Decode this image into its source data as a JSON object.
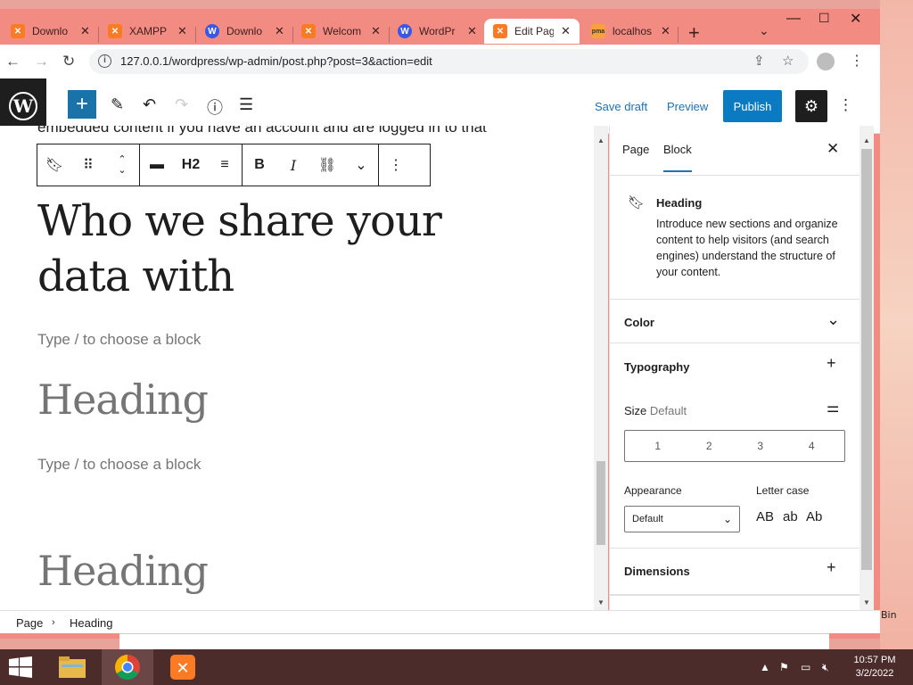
{
  "browser": {
    "tabs": [
      {
        "title": "Downlo",
        "icon": "xampp"
      },
      {
        "title": "XAMPP",
        "icon": "xampp"
      },
      {
        "title": "Downlo",
        "icon": "wordpress"
      },
      {
        "title": "Welcom",
        "icon": "xampp"
      },
      {
        "title": "WordPr",
        "icon": "wordpress"
      },
      {
        "title": "Edit Pag",
        "icon": "xampp"
      },
      {
        "title": "localhos",
        "icon": "phpmyadmin"
      }
    ],
    "active_tab": 5,
    "url": "127.0.0.1/wordpress/wp-admin/post.php?post=3&action=edit"
  },
  "wp_header": {
    "save_draft": "Save draft",
    "preview": "Preview",
    "publish": "Publish"
  },
  "editor": {
    "cut_text": "embedded content if you have an account and are logged in to that",
    "block_toolbar": {
      "heading_level": "H2"
    },
    "heading": "Who we share your data with",
    "placeholder_1": "Type / to choose a block",
    "heading_placeholder_1": "Heading",
    "placeholder_2": "Type / to choose a block",
    "heading_placeholder_2": "Heading"
  },
  "sidebar": {
    "tabs": {
      "page": "Page",
      "block": "Block"
    },
    "block_card": {
      "title": "Heading",
      "description": "Introduce new sections and organize content to help visitors (and search engines) understand the structure of your content."
    },
    "color_panel": "Color",
    "typography_panel": "Typography",
    "size_label": "Size",
    "size_value": "Default",
    "font_sizes": [
      "1",
      "2",
      "3",
      "4"
    ],
    "appearance_label": "Appearance",
    "appearance_value": "Default",
    "letter_case_label": "Letter case",
    "letter_case": {
      "upper": "AB",
      "lower": "ab",
      "capitalize": "Ab"
    },
    "dimensions_panel": "Dimensions"
  },
  "breadcrumb": {
    "root": "Page",
    "current": "Heading"
  },
  "desktop": {
    "recycle_bin_fragment": "Bin"
  },
  "taskbar": {
    "time": "10:57 PM",
    "date": "3/2/2022"
  },
  "colors": {
    "browser_frame": "#f28b82",
    "wp_accent": "#2271b1",
    "publish_bg": "#0a7bc2",
    "taskbar": "#4c2b2b"
  }
}
